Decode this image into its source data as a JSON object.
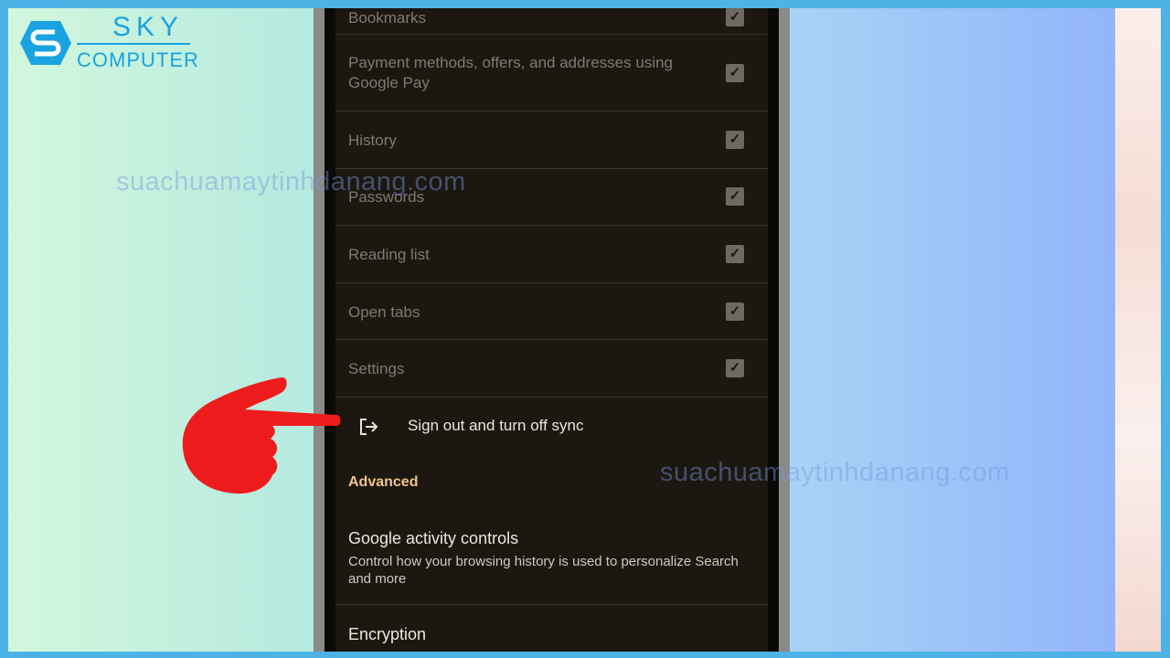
{
  "logo": {
    "line1": "SKY",
    "line2": "COMPUTER"
  },
  "watermark": "suachuamaytinhdanang.com",
  "sync_items": [
    {
      "label": "Bookmarks",
      "checked": true
    },
    {
      "label": "Payment methods, offers, and addresses using Google Pay",
      "checked": true
    },
    {
      "label": "History",
      "checked": true
    },
    {
      "label": "Passwords",
      "checked": true
    },
    {
      "label": "Reading list",
      "checked": true
    },
    {
      "label": "Open tabs",
      "checked": true
    },
    {
      "label": "Settings",
      "checked": true
    }
  ],
  "sign_out": {
    "label": "Sign out and turn off sync",
    "icon": "logout-icon"
  },
  "advanced": {
    "header": "Advanced",
    "activity_title": "Google activity controls",
    "activity_desc": "Control how your browsing history is used to personalize Search and more",
    "encryption": "Encryption"
  },
  "colors": {
    "accent": "#f0c58a",
    "frame": "#4db3e6",
    "pointer": "#ee1c1c"
  }
}
